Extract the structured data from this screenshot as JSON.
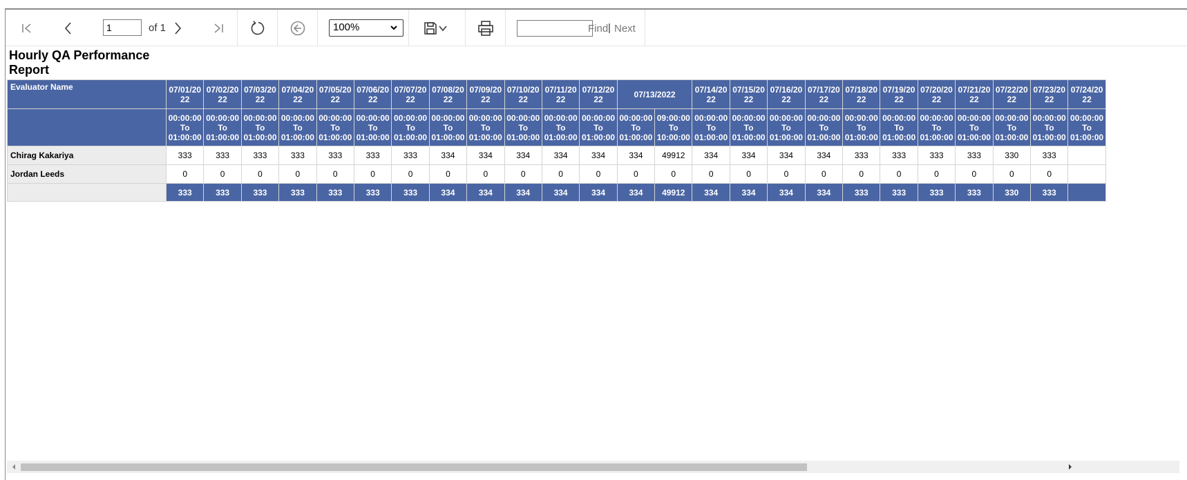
{
  "toolbar": {
    "page_value": "1",
    "page_of": "of 1",
    "zoom": "100%",
    "find_value": "",
    "find_label": "Find",
    "find_sep": "|",
    "next_label": "Next",
    "icons": [
      "first-page-icon",
      "previous-page-icon",
      "next-page-icon",
      "last-page-icon",
      "refresh-icon",
      "back-icon",
      "save-icon",
      "chevron-down-icon",
      "print-icon"
    ]
  },
  "report": {
    "title_line1": "Hourly QA Performance",
    "title_line2": "Report",
    "corner_header": "Evaluator Name",
    "header_color": "#4a65a3",
    "dates": [
      {
        "label": "07/01/2022",
        "span": 1
      },
      {
        "label": "07/02/2022",
        "span": 1
      },
      {
        "label": "07/03/2022",
        "span": 1
      },
      {
        "label": "07/04/2022",
        "span": 1
      },
      {
        "label": "07/05/2022",
        "span": 1
      },
      {
        "label": "07/06/2022",
        "span": 1
      },
      {
        "label": "07/07/2022",
        "span": 1
      },
      {
        "label": "07/08/2022",
        "span": 1
      },
      {
        "label": "07/09/2022",
        "span": 1
      },
      {
        "label": "07/10/2022",
        "span": 1
      },
      {
        "label": "07/11/2022",
        "span": 1
      },
      {
        "label": "07/12/2022",
        "span": 1
      },
      {
        "label": "07/13/2022",
        "span": 2
      },
      {
        "label": "07/14/2022",
        "span": 1
      },
      {
        "label": "07/15/2022",
        "span": 1
      },
      {
        "label": "07/16/2022",
        "span": 1
      },
      {
        "label": "07/17/2022",
        "span": 1
      },
      {
        "label": "07/18/2022",
        "span": 1
      },
      {
        "label": "07/19/2022",
        "span": 1
      },
      {
        "label": "07/20/2022",
        "span": 1
      },
      {
        "label": "07/21/2022",
        "span": 1
      },
      {
        "label": "07/22/2022",
        "span": 1
      },
      {
        "label": "07/23/2022",
        "span": 1
      },
      {
        "label": "07/24/2022",
        "span": 1
      }
    ],
    "time_slots": [
      "00:00:00 To 01:00:00",
      "00:00:00 To 01:00:00",
      "00:00:00 To 01:00:00",
      "00:00:00 To 01:00:00",
      "00:00:00 To 01:00:00",
      "00:00:00 To 01:00:00",
      "00:00:00 To 01:00:00",
      "00:00:00 To 01:00:00",
      "00:00:00 To 01:00:00",
      "00:00:00 To 01:00:00",
      "00:00:00 To 01:00:00",
      "00:00:00 To 01:00:00",
      "00:00:00 To 01:00:00",
      "09:00:00 To 10:00:00",
      "00:00:00 To 01:00:00",
      "00:00:00 To 01:00:00",
      "00:00:00 To 01:00:00",
      "00:00:00 To 01:00:00",
      "00:00:00 To 01:00:00",
      "00:00:00 To 01:00:00",
      "00:00:00 To 01:00:00",
      "00:00:00 To 01:00:00",
      "00:00:00 To 01:00:00",
      "00:00:00 To 01:00:00",
      "00:00:00 To 01:00:00"
    ],
    "rows": [
      {
        "name": "Chirag Kakariya",
        "values": [
          "333",
          "333",
          "333",
          "333",
          "333",
          "333",
          "333",
          "334",
          "334",
          "334",
          "334",
          "334",
          "334",
          "49912",
          "334",
          "334",
          "334",
          "334",
          "333",
          "333",
          "333",
          "333",
          "330",
          "333",
          ""
        ]
      },
      {
        "name": "Jordan Leeds",
        "values": [
          "0",
          "0",
          "0",
          "0",
          "0",
          "0",
          "0",
          "0",
          "0",
          "0",
          "0",
          "0",
          "0",
          "0",
          "0",
          "0",
          "0",
          "0",
          "0",
          "0",
          "0",
          "0",
          "0",
          "0",
          ""
        ]
      }
    ],
    "totals": {
      "name": "",
      "values": [
        "333",
        "333",
        "333",
        "333",
        "333",
        "333",
        "333",
        "334",
        "334",
        "334",
        "334",
        "334",
        "334",
        "49912",
        "334",
        "334",
        "334",
        "334",
        "333",
        "333",
        "333",
        "333",
        "330",
        "333",
        ""
      ]
    }
  }
}
